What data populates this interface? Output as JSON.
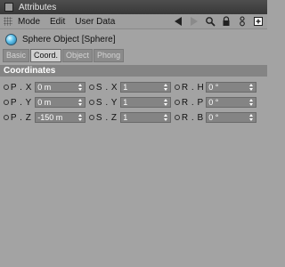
{
  "window": {
    "title": "Attributes"
  },
  "menu": {
    "items": [
      "Mode",
      "Edit",
      "User Data"
    ]
  },
  "toolbar": {
    "icons": [
      "back-arrow-icon",
      "forward-arrow-icon",
      "search-icon",
      "lock-icon",
      "settings-icon",
      "new-panel-icon"
    ]
  },
  "object": {
    "title": "Sphere Object [Sphere]"
  },
  "tabs": [
    {
      "label": "Basic",
      "active": false
    },
    {
      "label": "Coord.",
      "active": true
    },
    {
      "label": "Object",
      "active": false
    },
    {
      "label": "Phong",
      "active": false
    }
  ],
  "section": {
    "title": "Coordinates"
  },
  "coords": {
    "p_x": {
      "label": "P . X",
      "value": "0 m"
    },
    "p_y": {
      "label": "P . Y",
      "value": "0 m"
    },
    "p_z": {
      "label": "P . Z",
      "value": "-150 m"
    },
    "s_x": {
      "label": "S . X",
      "value": "1"
    },
    "s_y": {
      "label": "S . Y",
      "value": "1"
    },
    "s_z": {
      "label": "S . Z",
      "value": "1"
    },
    "r_h": {
      "label": "R . H",
      "value": "0 °"
    },
    "r_p": {
      "label": "R . P",
      "value": "0 °"
    },
    "r_b": {
      "label": "R . B",
      "value": "0 °"
    }
  },
  "colors": {
    "panel_bg": "#a3a3a3",
    "titlebar_bg": "#3e3e3e",
    "section_bg": "#848484",
    "field_bg": "#848484",
    "active_tab_bg": "#cfcfcf"
  }
}
